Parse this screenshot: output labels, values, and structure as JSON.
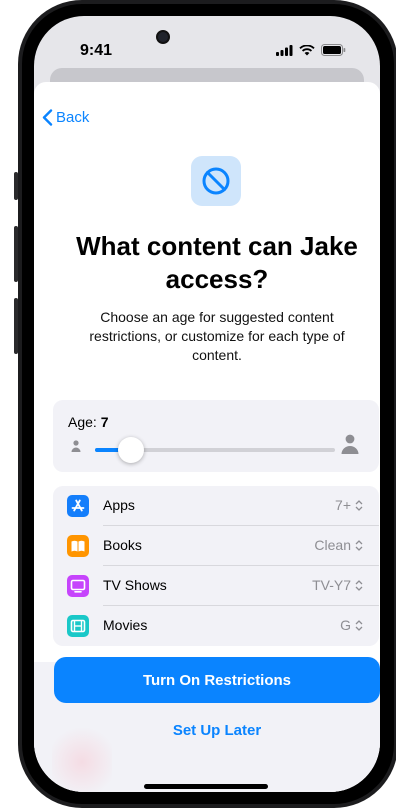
{
  "status": {
    "time": "9:41",
    "icons": [
      "cellular-signal-icon",
      "wifi-icon",
      "battery-icon"
    ]
  },
  "nav": {
    "back_label": "Back"
  },
  "hero_icon": "restriction-icon",
  "title": "What content can Jake access?",
  "subtitle": "Choose an age for suggested content restrictions, or customize for each type of content.",
  "age": {
    "label": "Age:",
    "value": "7",
    "slider_fraction": 0.15
  },
  "content_types": [
    {
      "icon": "app-store-icon",
      "label": "Apps",
      "value": "7+",
      "color": "#147efb"
    },
    {
      "icon": "books-icon",
      "label": "Books",
      "value": "Clean",
      "color": "#ff9500"
    },
    {
      "icon": "tv-icon",
      "label": "TV Shows",
      "value": "TV-Y7",
      "color": "#c644fc"
    },
    {
      "icon": "film-icon",
      "label": "Movies",
      "value": "G",
      "color": "#1ac8c8"
    }
  ],
  "actions": {
    "primary": "Turn On Restrictions",
    "secondary": "Set Up Later"
  },
  "colors": {
    "accent": "#0a84ff",
    "card": "#f2f2f7"
  }
}
